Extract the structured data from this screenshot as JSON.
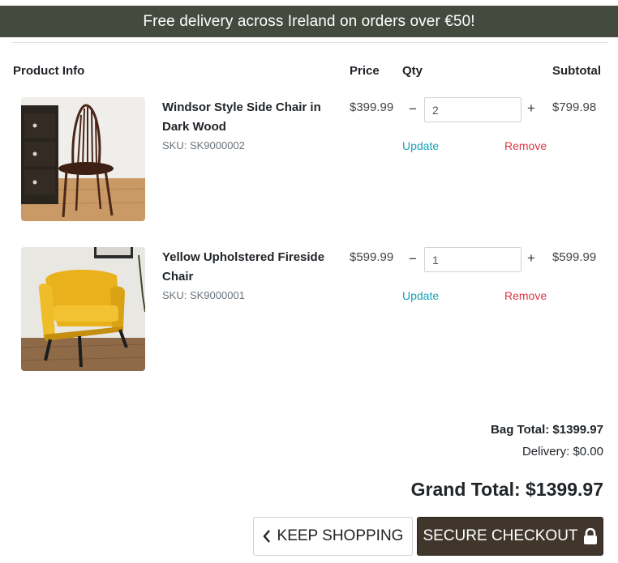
{
  "banner": {
    "text": "Free delivery across Ireland on orders over €50!"
  },
  "table": {
    "headers": {
      "product_info": "Product Info",
      "price": "Price",
      "qty": "Qty",
      "subtotal": "Subtotal"
    }
  },
  "items": [
    {
      "name_line1": "Windsor Style Side Chair in",
      "name_line2": "Dark Wood",
      "sku": "SKU: SK9000002",
      "price": "$399.99",
      "qty": "2",
      "subtotal": "$799.98",
      "update_label": "Update",
      "remove_label": "Remove",
      "decrement_label": "−",
      "increment_label": "+"
    },
    {
      "name_line1": "Yellow Upholstered Fireside",
      "name_line2": "Chair",
      "sku": "SKU: SK9000001",
      "price": "$599.99",
      "qty": "1",
      "subtotal": "$599.99",
      "update_label": "Update",
      "remove_label": "Remove",
      "decrement_label": "−",
      "increment_label": "+"
    }
  ],
  "totals": {
    "bag_total": "Bag Total: $1399.97",
    "delivery": "Delivery: $0.00",
    "grand_total": "Grand Total: $1399.97"
  },
  "buttons": {
    "keep_shopping": "KEEP SHOPPING",
    "secure_checkout": "SECURE CHECKOUT",
    "keep_icon": "chevron-left-icon",
    "secure_icon": "lock-icon"
  },
  "colors": {
    "banner_bg": "#454a3f",
    "update_link": "#17a2b8",
    "remove_link": "#dc3545",
    "checkout_bg": "#40362c"
  }
}
